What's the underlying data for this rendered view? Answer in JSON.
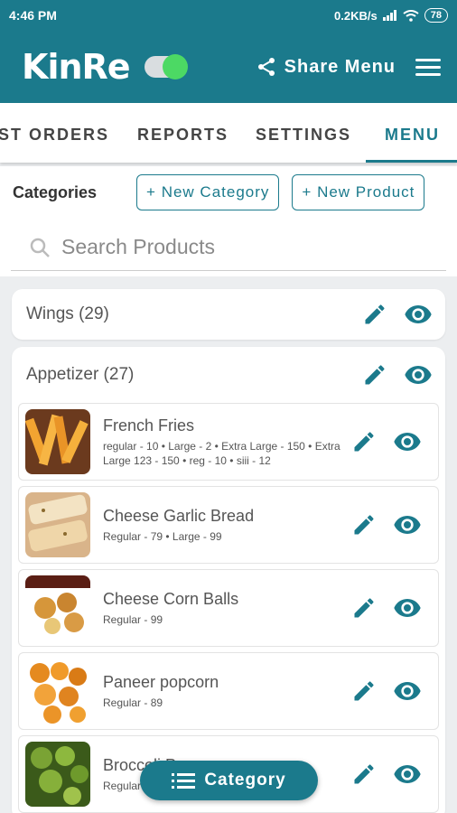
{
  "status": {
    "time": "4:46 PM",
    "speed": "0.2KB/s",
    "battery": "78"
  },
  "app": {
    "logo": "KinRe",
    "share_label": "Share Menu"
  },
  "tabs": [
    {
      "label": "ST ORDERS"
    },
    {
      "label": "REPORTS"
    },
    {
      "label": "SETTINGS"
    },
    {
      "label": "MENU",
      "active": true
    }
  ],
  "toolbar": {
    "categories_label": "Categories",
    "new_category": "+ New Category",
    "new_product": "+ New Product"
  },
  "search": {
    "placeholder": "Search Products"
  },
  "categories": [
    {
      "title": "Wings (29)"
    },
    {
      "title": "Appetizer (27)",
      "products": [
        {
          "name": "French Fries",
          "variants": "regular - 10 • Large - 2 • Extra Large - 150 • Extra Large 123 - 150 • reg - 10 • siii - 12"
        },
        {
          "name": "Cheese Garlic Bread",
          "variants": "Regular - 79 • Large - 99"
        },
        {
          "name": "Cheese Corn Balls",
          "variants": "Regular - 99"
        },
        {
          "name": "Paneer popcorn",
          "variants": "Regular - 89"
        },
        {
          "name": "Broccoli Popcorn",
          "variants": "Regular"
        }
      ]
    }
  ],
  "fab": {
    "label": "Category"
  },
  "colors": {
    "primary": "#1b7a8c",
    "toggle_on": "#4cd964"
  },
  "icons": {
    "edit": "pencil-icon",
    "visibility": "eye-icon",
    "share": "share-icon",
    "menu": "hamburger-icon",
    "search": "search-icon",
    "list": "list-icon"
  }
}
